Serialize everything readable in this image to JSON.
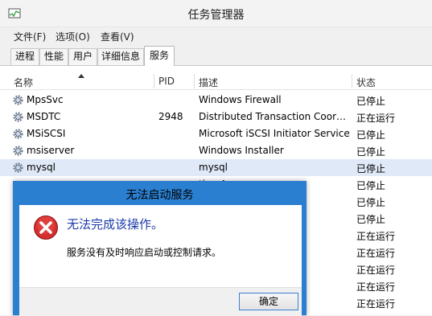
{
  "window": {
    "title": "任务管理器"
  },
  "menu": [
    "文件(F)",
    "选项(O)",
    "查看(V)"
  ],
  "tabs": [
    "进程",
    "性能",
    "用户",
    "详细信息",
    "服务"
  ],
  "active_tab": "服务",
  "columns": {
    "name": "名称",
    "pid": "PID",
    "description": "描述",
    "status": "状态"
  },
  "rows": [
    {
      "name": "MpsSvc",
      "pid": "",
      "description": "Windows Firewall",
      "status": "已停止"
    },
    {
      "name": "MSDTC",
      "pid": "2948",
      "description": "Distributed Transaction Coor…",
      "status": "正在运行"
    },
    {
      "name": "MSiSCSI",
      "pid": "",
      "description": "Microsoft iSCSI Initiator Service",
      "status": "已停止"
    },
    {
      "name": "msiserver",
      "pid": "",
      "description": "Windows Installer",
      "status": "已停止"
    },
    {
      "name": "mysql",
      "pid": "",
      "description": "mysql",
      "status": "已停止"
    },
    {
      "name": "",
      "pid": "",
      "description": "tion A…",
      "status": "已停止"
    },
    {
      "name": "",
      "pid": "",
      "description": "ssistant",
      "status": "已停止"
    },
    {
      "name": "",
      "pid": "",
      "description": "",
      "status": "已停止"
    },
    {
      "name": "",
      "pid": "",
      "description": "",
      "status": "正在运行"
    },
    {
      "name": "",
      "pid": "",
      "description": "",
      "status": "正在运行"
    },
    {
      "name": "",
      "pid": "",
      "description": "ervice",
      "status": "正在运行"
    },
    {
      "name": "",
      "pid": "",
      "description": "reness",
      "status": "正在运行"
    },
    {
      "name": "",
      "pid": "",
      "description": "e Servi…",
      "status": "正在运行"
    }
  ],
  "dialog": {
    "title": "无法启动服务",
    "main_text": "无法完成该操作。",
    "sub_text": "服务没有及时响应启动或控制请求。",
    "ok_label": "确定"
  }
}
